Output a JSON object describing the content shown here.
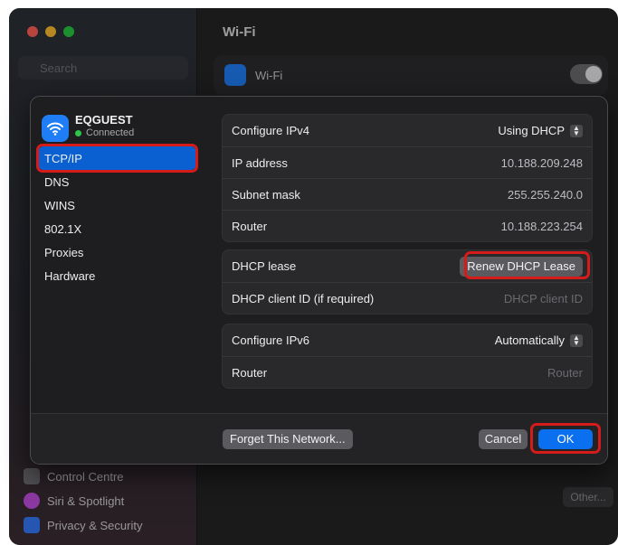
{
  "background": {
    "title": "Wi-Fi",
    "search_placeholder": "Search",
    "wifi_toggle_label": "Wi-Fi",
    "other_button": "Other...",
    "sidebar_items": [
      {
        "label": "Control Centre",
        "color": "#6e6e73"
      },
      {
        "label": "Siri & Spotlight",
        "color": "#c24ee0"
      },
      {
        "label": "Privacy & Security",
        "color": "#3478f6"
      }
    ]
  },
  "network": {
    "name": "EQGUEST",
    "status": "Connected"
  },
  "nav": {
    "items": [
      "TCP/IP",
      "DNS",
      "WINS",
      "802.1X",
      "Proxies",
      "Hardware"
    ],
    "selected": "TCP/IP"
  },
  "ipv4": {
    "configure_label": "Configure IPv4",
    "configure_value": "Using DHCP",
    "ip_label": "IP address",
    "ip_value": "10.188.209.248",
    "subnet_label": "Subnet mask",
    "subnet_value": "255.255.240.0",
    "router_label": "Router",
    "router_value": "10.188.223.254"
  },
  "dhcp": {
    "lease_label": "DHCP lease",
    "renew_button": "Renew DHCP Lease",
    "client_id_label": "DHCP client ID (if required)",
    "client_id_placeholder": "DHCP client ID"
  },
  "ipv6": {
    "configure_label": "Configure IPv6",
    "configure_value": "Automatically",
    "router_label": "Router",
    "router_placeholder": "Router"
  },
  "footer": {
    "forget_button": "Forget This Network...",
    "cancel_button": "Cancel",
    "ok_button": "OK"
  },
  "colors": {
    "accent": "#0a70f0",
    "selection": "#0a5fd1",
    "highlight": "#d61b1b"
  },
  "icons": {
    "network": "wifi-icon",
    "status": "green-dot-icon",
    "popup": "up-down-chevron-icon"
  }
}
